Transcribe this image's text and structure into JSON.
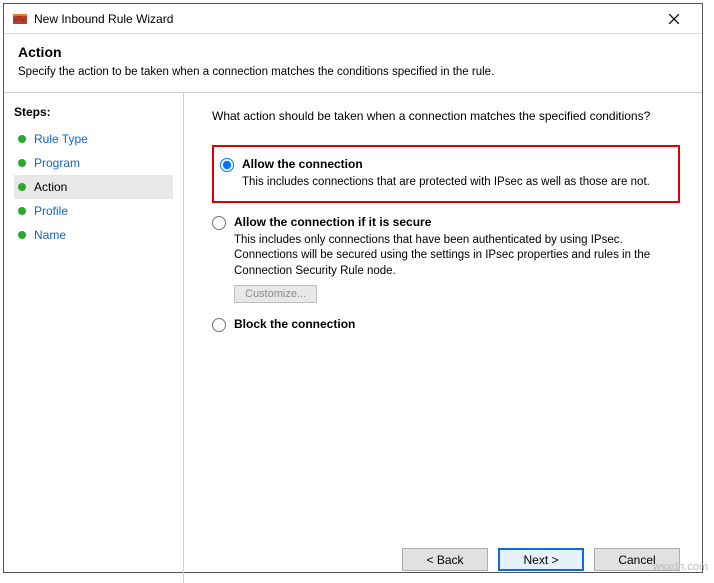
{
  "window": {
    "title": "New Inbound Rule Wizard"
  },
  "header": {
    "title": "Action",
    "subtitle": "Specify the action to be taken when a connection matches the conditions specified in the rule."
  },
  "sidebar": {
    "title": "Steps:",
    "items": [
      {
        "label": "Rule Type"
      },
      {
        "label": "Program"
      },
      {
        "label": "Action"
      },
      {
        "label": "Profile"
      },
      {
        "label": "Name"
      }
    ]
  },
  "main": {
    "prompt": "What action should be taken when a connection matches the specified conditions?",
    "options": [
      {
        "title": "Allow the connection",
        "desc": "This includes connections that are protected with IPsec as well as those are not."
      },
      {
        "title": "Allow the connection if it is secure",
        "desc": "This includes only connections that have been authenticated by using IPsec. Connections will be secured using the settings in IPsec properties and rules in the Connection Security Rule node.",
        "customize": "Customize..."
      },
      {
        "title": "Block the connection"
      }
    ]
  },
  "footer": {
    "back": "< Back",
    "next": "Next >",
    "cancel": "Cancel"
  },
  "watermark": "wsxdn.com"
}
